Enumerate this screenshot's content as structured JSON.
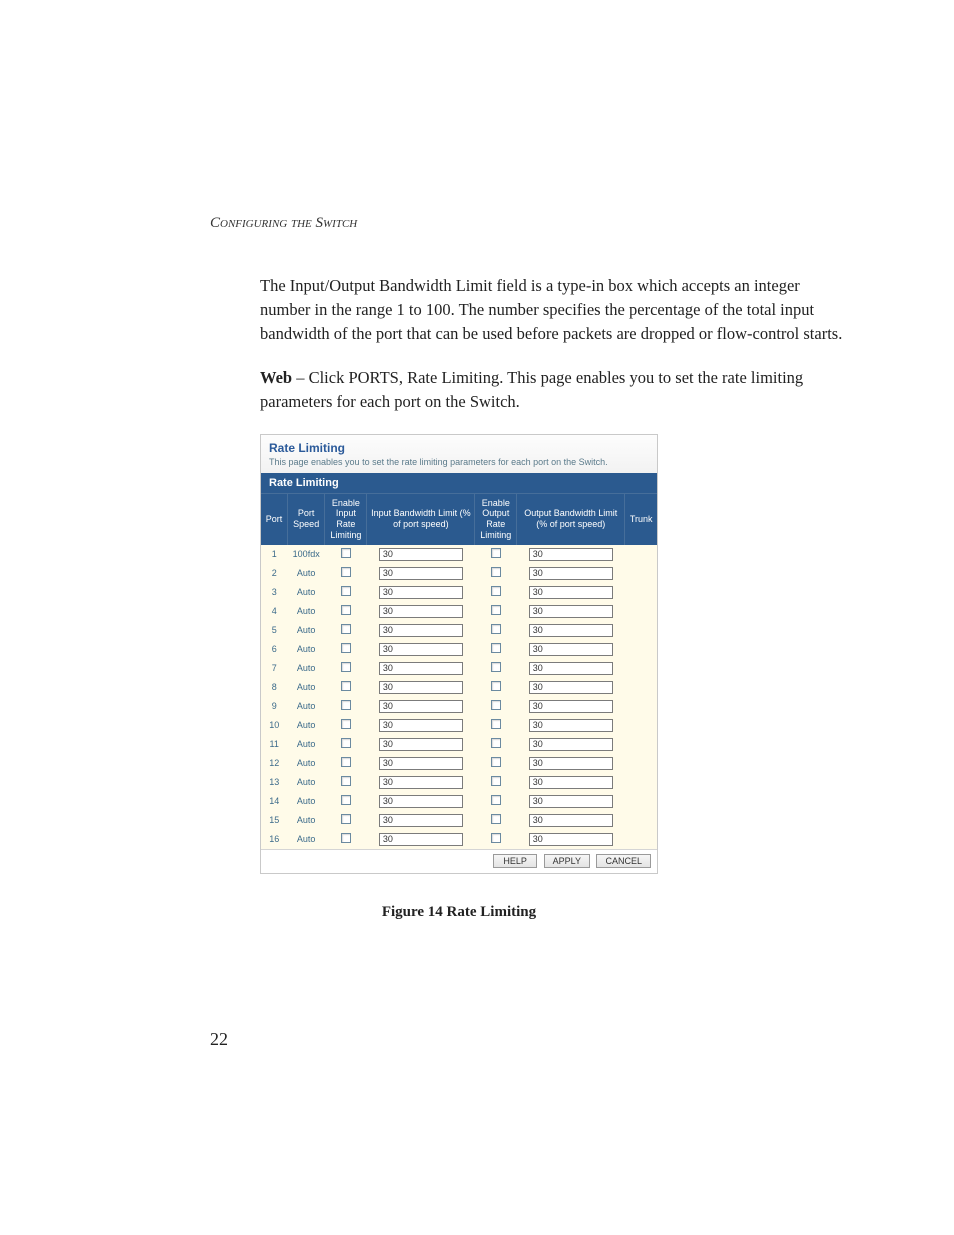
{
  "running_head": "Configuring the Switch",
  "para1": "The Input/Output Bandwidth Limit field is a type-in box which accepts an integer number in the range 1 to 100. The number specifies the percentage of the total input bandwidth of the port that can be used before packets are dropped or flow-control starts.",
  "para2_lead": "Web",
  "para2_rest": " – Click PORTS, Rate Limiting. This page enables you to set the rate limiting parameters for each port on the Switch.",
  "shot": {
    "title": "Rate Limiting",
    "desc": "This page enables you to set the rate limiting parameters for each port on the Switch.",
    "panel_head": "Rate Limiting",
    "headers": {
      "port": "Port",
      "speed": "Port Speed",
      "en_in": "Enable Input Rate Limiting",
      "in_bw": "Input Bandwidth Limit (% of port speed)",
      "en_out": "Enable Output Rate Limiting",
      "out_bw": "Output Bandwidth Limit (% of port speed)",
      "trunk": "Trunk"
    },
    "rows": [
      {
        "port": "1",
        "speed": "100fdx",
        "in": "30",
        "out": "30"
      },
      {
        "port": "2",
        "speed": "Auto",
        "in": "30",
        "out": "30"
      },
      {
        "port": "3",
        "speed": "Auto",
        "in": "30",
        "out": "30"
      },
      {
        "port": "4",
        "speed": "Auto",
        "in": "30",
        "out": "30"
      },
      {
        "port": "5",
        "speed": "Auto",
        "in": "30",
        "out": "30"
      },
      {
        "port": "6",
        "speed": "Auto",
        "in": "30",
        "out": "30"
      },
      {
        "port": "7",
        "speed": "Auto",
        "in": "30",
        "out": "30"
      },
      {
        "port": "8",
        "speed": "Auto",
        "in": "30",
        "out": "30"
      },
      {
        "port": "9",
        "speed": "Auto",
        "in": "30",
        "out": "30"
      },
      {
        "port": "10",
        "speed": "Auto",
        "in": "30",
        "out": "30"
      },
      {
        "port": "11",
        "speed": "Auto",
        "in": "30",
        "out": "30"
      },
      {
        "port": "12",
        "speed": "Auto",
        "in": "30",
        "out": "30"
      },
      {
        "port": "13",
        "speed": "Auto",
        "in": "30",
        "out": "30"
      },
      {
        "port": "14",
        "speed": "Auto",
        "in": "30",
        "out": "30"
      },
      {
        "port": "15",
        "speed": "Auto",
        "in": "30",
        "out": "30"
      },
      {
        "port": "16",
        "speed": "Auto",
        "in": "30",
        "out": "30"
      }
    ],
    "buttons": {
      "help": "HELP",
      "apply": "APPLY",
      "cancel": "CANCEL"
    }
  },
  "figure_caption": "Figure 14  Rate Limiting",
  "page_number": "22"
}
